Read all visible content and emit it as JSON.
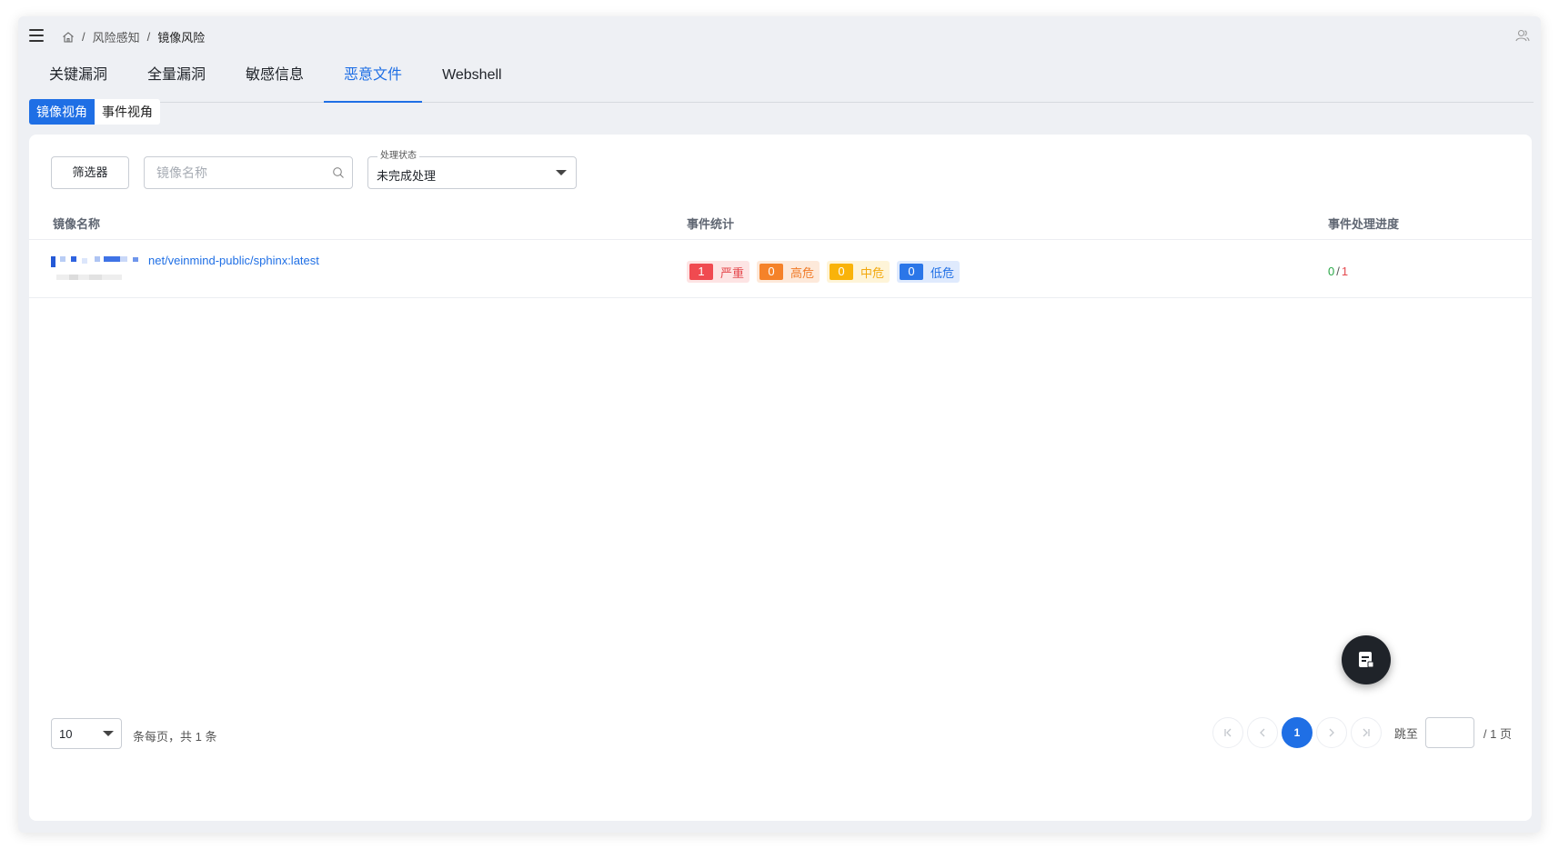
{
  "breadcrumb": {
    "items": [
      "风险感知",
      "镜像风险"
    ],
    "separator": "/"
  },
  "tabs": [
    {
      "label": "关键漏洞",
      "active": false
    },
    {
      "label": "全量漏洞",
      "active": false
    },
    {
      "label": "敏感信息",
      "active": false
    },
    {
      "label": "恶意文件",
      "active": true
    },
    {
      "label": "Webshell",
      "active": false
    }
  ],
  "view_switch": {
    "image_view": "镜像视角",
    "event_view": "事件视角"
  },
  "toolbar": {
    "filter_label": "筛选器",
    "search_placeholder": "镜像名称",
    "status_select": {
      "legend": "处理状态",
      "value": "未完成处理"
    }
  },
  "table": {
    "headers": {
      "name": "镜像名称",
      "stats": "事件统计",
      "progress": "事件处理进度"
    },
    "rows": [
      {
        "image_name": "net/veinmind-public/sphinx:latest",
        "counts": {
          "critical": {
            "count": "1",
            "label": "严重"
          },
          "high": {
            "count": "0",
            "label": "高危"
          },
          "medium": {
            "count": "0",
            "label": "中危"
          },
          "low": {
            "count": "0",
            "label": "低危"
          }
        },
        "progress": {
          "done": "0",
          "separator": "/",
          "total": "1"
        }
      }
    ]
  },
  "pagination": {
    "page_size": "10",
    "summary": "条每页，共 1 条",
    "current_page": "1",
    "jump_label": "跳至",
    "total_pages": "/ 1 页"
  },
  "colors": {
    "accent": "#1f6fe5",
    "critical": "#f04a50",
    "high": "#f58229",
    "medium": "#f9b30a",
    "low": "#2b76e8",
    "done": "#2aa748"
  },
  "icons": [
    "menu-icon",
    "home-icon",
    "user-icon",
    "search-icon",
    "chevron-down-icon",
    "first-page-icon",
    "prev-page-icon",
    "next-page-icon",
    "last-page-icon",
    "document-icon"
  ]
}
